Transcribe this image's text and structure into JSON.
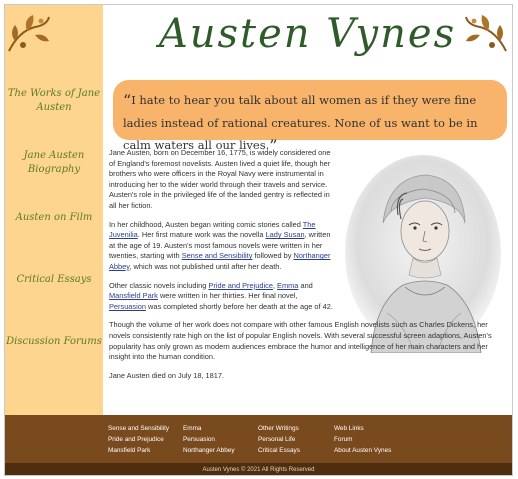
{
  "header": {
    "title": "Austen Vynes",
    "ornament_left": "floral-ornament-icon",
    "ornament_right": "floral-ornament-icon"
  },
  "sidebar": {
    "items": [
      {
        "label_line1": "The Works of Jane",
        "label_line2": "Austen"
      },
      {
        "label_line1": "Jane Austen",
        "label_line2": "Biography"
      },
      {
        "label_line1": "Austen on Film",
        "label_line2": ""
      },
      {
        "label_line1": "Critical Essays",
        "label_line2": ""
      },
      {
        "label_line1": "Discussion Forums",
        "label_line2": ""
      }
    ]
  },
  "quote": {
    "open": "“",
    "text": "I hate to hear you talk about all women as if they were fine ladies instead of rational creatures. None of us want to be in calm waters all our lives.",
    "close": "”"
  },
  "bio": {
    "p1": "Jane Austen, born on December 16, 1775, is widely considered one of England's foremost novelists. Austen lived a quiet life, though her brothers who were officers in the Royal Navy were instrumental in introducing her to the wider world through their travels and service. Austen's role in the privileged life of the landed gentry is reflected in all her fiction.",
    "p2_a": "In her childhood, Austen began writing comic stories called ",
    "p2_link1": "The Juvenilia",
    "p2_b": ". Her first mature work was the novella ",
    "p2_link2": "Lady Susan",
    "p2_c": ", written at the age of 19. Austen's most famous novels were written in her twenties, starting with ",
    "p2_link3": "Sense and Sensibility",
    "p2_d": " followed by ",
    "p2_link4": "Northanger Abbey",
    "p2_e": ", which was not published until after her death.",
    "p3_a": "Other classic novels including ",
    "p3_link1": "Pride and Prejudice",
    "p3_b": ", ",
    "p3_link2": "Emma",
    "p3_c": " and ",
    "p3_link3": "Mansfield Park",
    "p3_d": " were written in her thirties. Her final novel, ",
    "p3_link4": "Persuasion",
    "p3_e": " was completed shortly before her death at the age of 42.",
    "p4": "Though the volume of her work does not compare with other famous English novelists such as Charles Dickens, her novels consistently rate high on the list of popular English novels. With several successful screen adaptions, Austen's popularity has only grown as modern audiences embrace the humor and intelligence of her main characters and her insight into the human condition.",
    "p5": "Jane Austen died on July 18, 1817."
  },
  "footer": {
    "col1": [
      "Sense and Sensibility",
      "Pride and Prejudice",
      "Mansfield Park"
    ],
    "col2": [
      "Emma",
      "Persuasion",
      "Northanger Abbey"
    ],
    "col3": [
      "Other Writings",
      "Personal Life",
      "Critical Essays"
    ],
    "col4": [
      "Web Links",
      "Forum",
      "About Austen Vynes"
    ],
    "copyright": "Austen Vynes © 2021 All Rights Reserved"
  },
  "colors": {
    "sidebar": "#fdd58e",
    "quote_bg": "#f7b46a",
    "title": "#2f5a2a",
    "footer": "#7a4a1f",
    "copyright_bar": "#4f2e10",
    "link": "#2a3d8f"
  }
}
